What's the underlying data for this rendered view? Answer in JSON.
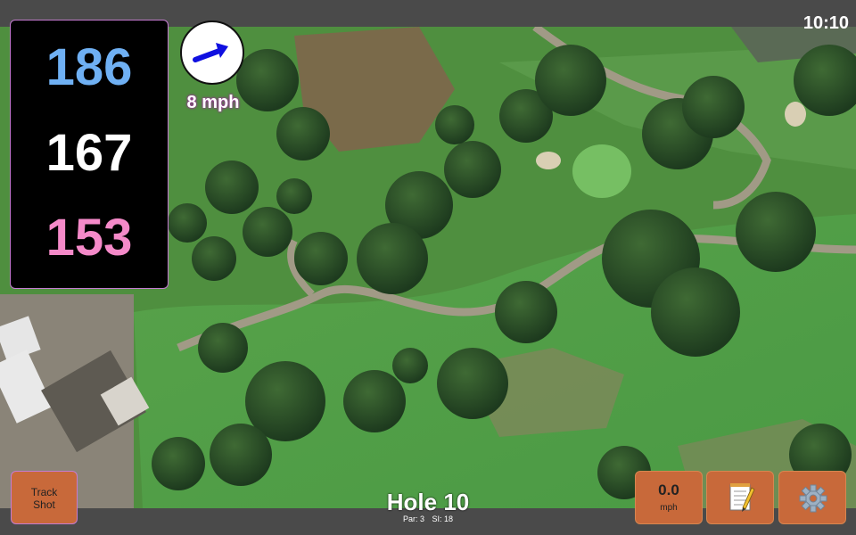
{
  "status": {
    "time": "10:10"
  },
  "distances": {
    "back": "186",
    "middle": "167",
    "front": "153"
  },
  "wind": {
    "speed_label": "8 mph"
  },
  "buttons": {
    "track_shot_label": "Track\nShot",
    "speed_value": "0.0",
    "speed_unit": "mph"
  },
  "hole": {
    "title": "Hole 10",
    "par": "Par: 3",
    "si": "SI: 18"
  },
  "icons": {
    "wind_arrow": "arrow-icon",
    "notes": "notepad-icon",
    "settings": "gear-icon"
  },
  "colors": {
    "back": "#6fb0f3",
    "middle": "#ffffff",
    "front": "#f58ac9",
    "button": "#c8693a",
    "accent_border": "#c47bd0",
    "wind_arrow": "#1010e0"
  }
}
